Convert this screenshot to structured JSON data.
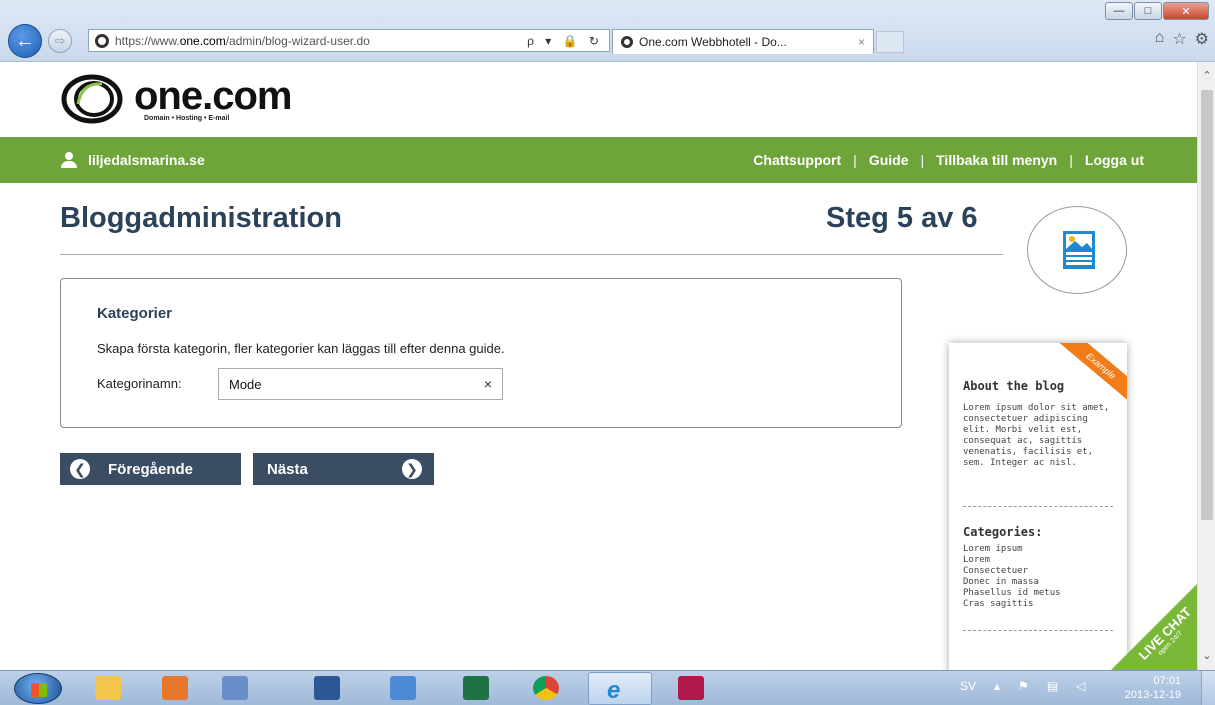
{
  "browser": {
    "url_prefix": "https://www.",
    "url_domain": "one.com",
    "url_path": "/admin/blog-wizard-user.do",
    "addr_tools": "ρ ▾ 🔒 ↻",
    "tab_title": "One.com Webbhotell - Do...",
    "tab_close": "×",
    "min_label": "—",
    "max_label": "□",
    "close_label": "✕"
  },
  "site": {
    "logo_name": "one.com",
    "logo_tagline": "Domain • Hosting • E-mail",
    "user_domain": "liljedalsmarina.se",
    "nav": [
      "Chattsupport",
      "Guide",
      "Tillbaka till menyn",
      "Logga ut"
    ],
    "nav_separator": "|"
  },
  "page": {
    "title": "Bloggadministration",
    "step": "Steg 5 av 6"
  },
  "form": {
    "section_title": "Kategorier",
    "description": "Skapa första kategorin, fler kategorier kan läggas till efter denna guide.",
    "field_label": "Kategorinamn:",
    "field_value": "Mode",
    "clear_icon": "×"
  },
  "buttons": {
    "prev": "Föregående",
    "next": "Nästa",
    "prev_icon": "❮",
    "next_icon": "❯"
  },
  "preview": {
    "ribbon": "Example",
    "about_heading": "About the blog",
    "about_text": "Lorem ipsum dolor sit amet, consectetuer adipiscing elit. Morbi velit est, consequat ac, sagittis venenatis, facilisis et, sem. Integer ac nisl.",
    "categories_heading": "Categories:",
    "categories": [
      "Lorem ipsum",
      "Lorem",
      "Consectetuer",
      "Donec in massa",
      "Phasellus id metus",
      "Cras sagittis"
    ]
  },
  "livechat": {
    "label": "LIVE CHAT",
    "sub": "open 24/7"
  },
  "taskbar": {
    "lang": "SV",
    "time": "07:01",
    "date": "2013-12-19"
  },
  "colors": {
    "brand_green": "#6fa43a",
    "heading_navy": "#2c4259",
    "button_navy": "#3a4d63",
    "ribbon_orange": "#f07d1a"
  }
}
